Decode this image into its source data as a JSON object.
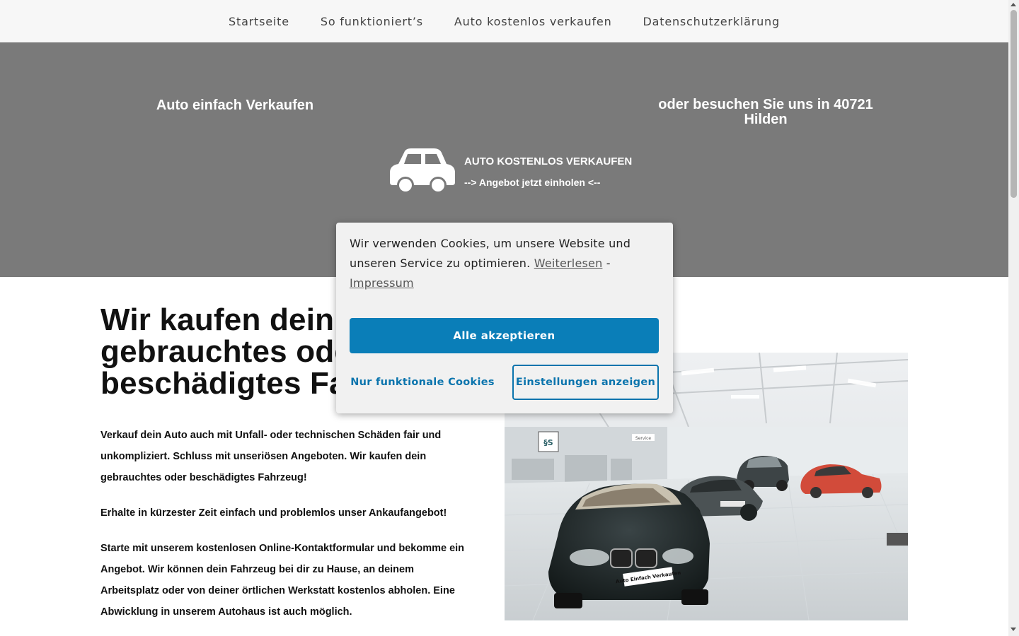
{
  "nav": {
    "items": [
      {
        "label": "Startseite"
      },
      {
        "label": "So funktioniert’s"
      },
      {
        "label": "Auto kostenlos verkaufen"
      },
      {
        "label": "Datenschutzerklärung"
      }
    ]
  },
  "hero": {
    "left_text": "Auto einfach Verkaufen",
    "right_text": "oder besuchen Sie uns in 40721 Hilden",
    "cta_title": "AUTO KOSTENLOS VERKAUFEN",
    "cta_sub": "--> Angebot jetzt einholen <--",
    "icon": "car-icon",
    "background": "#7a7a7a"
  },
  "main": {
    "headline": "Wir kaufen dein gebrauchtes oder beschädigtes Fahrzeug",
    "paragraphs": [
      "Verkauf dein Auto auch mit Unfall- oder technischen Schäden fair und unkompliziert. Schluss mit unseriösen Angeboten. Wir kaufen dein gebrauchtes oder beschädigtes Fahrzeug!",
      "Erhalte in kürzester Zeit einfach und problemlos unser Ankaufangebot!",
      "Starte mit unserem kostenlosen Online-Kontaktformular und bekomme ein Angebot. Wir können dein Fahrzeug bei dir zu Hause, an deinem Arbeitsplatz oder von deiner örtlichen Werkstatt kostenlos abholen. Eine Abwicklung  in unserem Autohaus ist auch möglich."
    ],
    "image": {
      "plate_text": "Auto Einfach Verkaufen",
      "sign_text": "Service"
    }
  },
  "cookie": {
    "text": "Wir verwenden Cookies, um unsere Website und unseren Service zu optimieren.",
    "link_more": "Weiterlesen",
    "separator": "-",
    "link_imprint": "Impressum",
    "accept_label": "Alle akzeptieren",
    "functional_label": "Nur funktionale Cookies",
    "settings_label": "Einstellungen anzeigen",
    "accent": "#0a7eb8"
  }
}
